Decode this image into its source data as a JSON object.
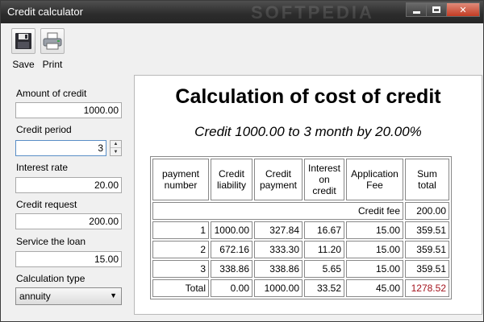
{
  "window": {
    "title": "Credit calculator",
    "watermark": "SOFTPEDIA"
  },
  "toolbar": {
    "save_label": "Save",
    "print_label": "Print"
  },
  "form": {
    "amount_label": "Amount of credit",
    "amount_value": "1000.00",
    "period_label": "Credit period",
    "period_value": "3",
    "rate_label": "Interest rate",
    "rate_value": "20.00",
    "request_label": "Credit request",
    "request_value": "200.00",
    "service_label": "Service the loan",
    "service_value": "15.00",
    "calc_type_label": "Calculation type",
    "calc_type_value": "annuity"
  },
  "report": {
    "title": "Calculation of cost of credit",
    "subtitle": "Credit 1000.00 to 3 month by 20.00%",
    "headers": [
      "payment number",
      "Credit liability",
      "Credit payment",
      "Interest on credit",
      "Application Fee",
      "Sum total"
    ],
    "fee_label": "Credit fee",
    "fee_value": "200.00",
    "rows": [
      [
        "1",
        "1000.00",
        "327.84",
        "16.67",
        "15.00",
        "359.51"
      ],
      [
        "2",
        "672.16",
        "333.30",
        "11.20",
        "15.00",
        "359.51"
      ],
      [
        "3",
        "338.86",
        "338.86",
        "5.65",
        "15.00",
        "359.51"
      ]
    ],
    "total": [
      "Total",
      "0.00",
      "1000.00",
      "33.52",
      "45.00",
      "1278.52"
    ]
  },
  "colors": {
    "total_sum": "#a4131d",
    "titlebar": "#2c2c2c"
  },
  "icons": {
    "save": "floppy-disk-icon",
    "print": "printer-icon"
  }
}
